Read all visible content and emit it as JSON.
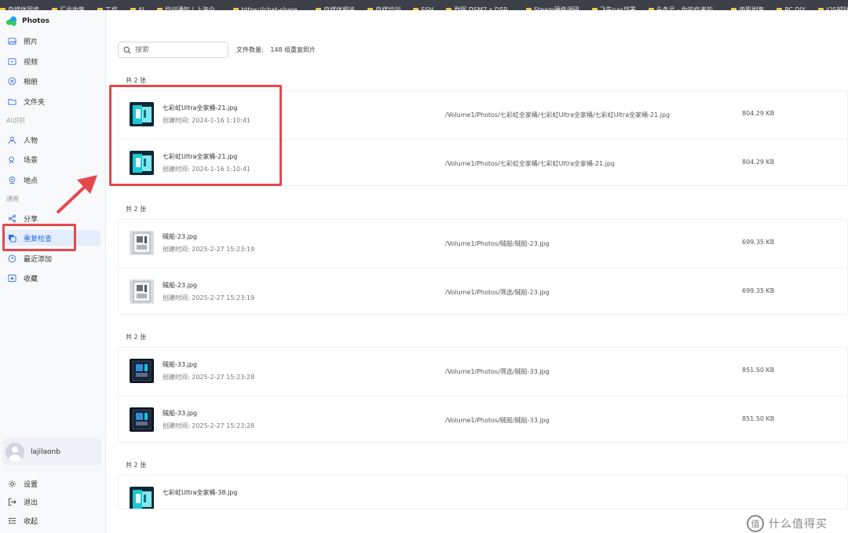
{
  "bookmarks": [
    "自媒体同步",
    "汇总收集",
    "工作",
    "AI",
    "培训通知 | 上海企...",
    "https://chat-share...",
    "自媒体相关",
    "自媒培训",
    "SSH",
    "群晖 DSM7.x DS9...",
    "Steam硬件调研",
    "飞牛nas部署",
    "头条号 - 你的作者的...",
    "电影剧集",
    "PC DIY",
    "iOS越狱源收录"
  ],
  "app": {
    "name": "Photos",
    "accent_color": "#2a6fdc",
    "annotation_color": "#e5484d"
  },
  "sidebar": {
    "items_top": [
      {
        "label": "照片",
        "icon": "image-icon"
      },
      {
        "label": "视频",
        "icon": "video-icon"
      },
      {
        "label": "相册",
        "icon": "album-icon"
      },
      {
        "label": "文件夹",
        "icon": "folder-icon"
      }
    ],
    "section_ai": "AI识别",
    "items_ai": [
      {
        "label": "人物",
        "icon": "person-icon"
      },
      {
        "label": "场景",
        "icon": "scene-icon"
      },
      {
        "label": "地点",
        "icon": "location-icon"
      }
    ],
    "section_general": "通用",
    "items_general": [
      {
        "label": "分享",
        "icon": "share-icon"
      },
      {
        "label": "重复检查",
        "icon": "duplicate-icon",
        "active": true
      },
      {
        "label": "最近添加",
        "icon": "clock-icon"
      },
      {
        "label": "收藏",
        "icon": "favorite-icon"
      }
    ],
    "user": {
      "name": "lajilaonb"
    },
    "bottom_items": [
      {
        "label": "设置",
        "icon": "gear-icon"
      },
      {
        "label": "退出",
        "icon": "logout-icon"
      },
      {
        "label": "收起",
        "icon": "collapse-icon"
      }
    ]
  },
  "toolbar": {
    "search_placeholder": "搜索",
    "file_count_label": "文件数量:",
    "file_count_value": "148 组重复照片"
  },
  "groups": [
    {
      "title": "共 2 张",
      "files": [
        {
          "name": "七彩虹Ultra全家桶-21.jpg",
          "created": "创建时间: 2024-1-16 1:10:41",
          "path": "/Volume1/Photos/七彩虹全家桶/七彩虹Ultra全家桶/七彩虹Ultra全家桶-21.jpg",
          "size": "804.29 KB",
          "thumb": "cyan"
        },
        {
          "name": "七彩虹Ultra全家桶-21.jpg",
          "created": "创建时间: 2024-1-16 1:10:41",
          "path": "/Volume1/Photos/七彩虹全家桶/七彩虹Ultra全家桶-21.jpg",
          "size": "804.29 KB",
          "thumb": "cyan"
        }
      ]
    },
    {
      "title": "共 2 张",
      "files": [
        {
          "name": "贼船-23.jpg",
          "created": "创建时间: 2025-2-27 15:23:19",
          "path": "/Volume1/Photos/贼船/贼船-23.jpg",
          "size": "699.35 KB",
          "thumb": "white"
        },
        {
          "name": "贼船-23.jpg",
          "created": "创建时间: 2025-2-27 15:23:19",
          "path": "/Volume1/Photos/筛选/贼船-23.jpg",
          "size": "699.35 KB",
          "thumb": "white"
        }
      ]
    },
    {
      "title": "共 2 张",
      "files": [
        {
          "name": "贼船-33.jpg",
          "created": "创建时间: 2025-2-27 15:23:28",
          "path": "/Volume1/Photos/筛选/贼船-33.jpg",
          "size": "851.50 KB",
          "thumb": "dark"
        },
        {
          "name": "贼船-33.jpg",
          "created": "创建时间: 2025-2-27 15:23:28",
          "path": "/Volume1/Photos/贼船/贼船-33.jpg",
          "size": "851.50 KB",
          "thumb": "dark"
        }
      ]
    },
    {
      "title": "共 2 张",
      "files": [
        {
          "name": "七彩虹Ultra全家桶-38.jpg",
          "created": "",
          "path": "",
          "size": "",
          "thumb": "cyan"
        }
      ]
    }
  ],
  "watermark": {
    "symbol": "值",
    "text": "什么值得买"
  }
}
